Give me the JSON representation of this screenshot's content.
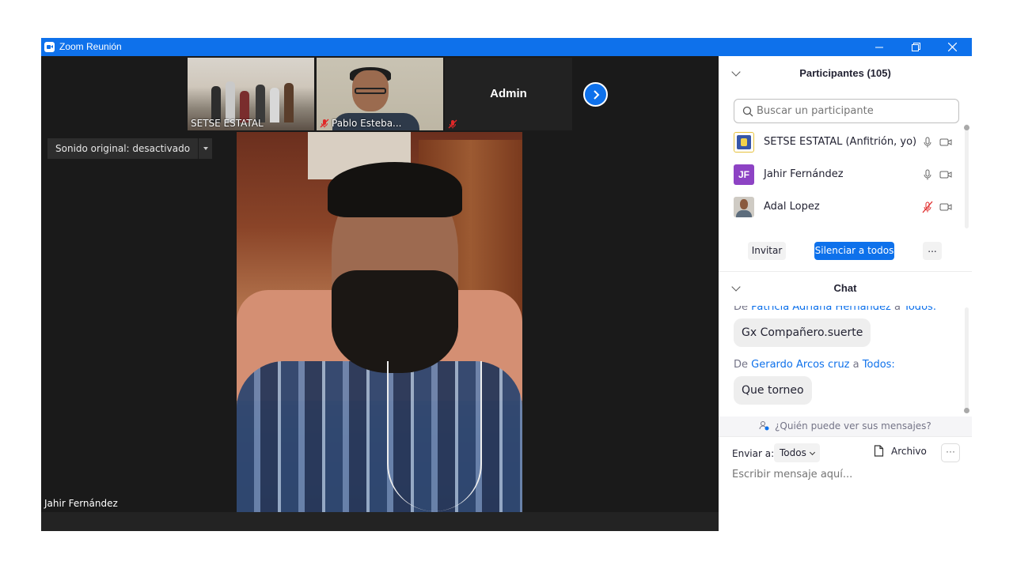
{
  "window": {
    "title": "Zoom Reunión"
  },
  "thumbnails": [
    {
      "label": "SETSE ESTATAL"
    },
    {
      "label": "Pablo Esteba..."
    },
    {
      "label": "Admin"
    }
  ],
  "video": {
    "sound_toggle": "Sonido original: desactivado",
    "active_speaker": "Jahir Fernández"
  },
  "participants": {
    "title": "Participantes (105)",
    "search_placeholder": "Buscar un participante",
    "list": [
      {
        "name": "SETSE ESTATAL (Anfitrión, yo)",
        "avatar": "logo",
        "mic": "on",
        "video": "off"
      },
      {
        "name": "Jahir Fernández",
        "avatar_initials": "JF",
        "mic": "on",
        "video": "off"
      },
      {
        "name": "Adal Lopez",
        "avatar": "photo",
        "mic": "muted",
        "video": "off"
      }
    ],
    "invite_label": "Invitar",
    "mute_all_label": "Silenciar a todos",
    "more_label": "..."
  },
  "chat": {
    "title": "Chat",
    "messages": [
      {
        "from_prefix": "De",
        "from": "Patricia Adriana Hernández",
        "to_prefix": "a",
        "to": "Todos:",
        "text": "Gx Compañero.suerte"
      },
      {
        "from_prefix": "De",
        "from": "Gerardo Arcos cruz",
        "to_prefix": "a",
        "to": "Todos:",
        "text": "Que torneo"
      }
    ],
    "who_sees": "¿Quién puede ver sus mensajes?",
    "send_to_label": "Enviar a:",
    "send_to_value": "Todos",
    "file_label": "Archivo",
    "more_label": "···",
    "input_placeholder": "Escribir mensaje aquí..."
  },
  "colors": {
    "accent": "#0e71eb",
    "muted_red": "#e02828",
    "avatar_jf": "#8d43c4"
  }
}
